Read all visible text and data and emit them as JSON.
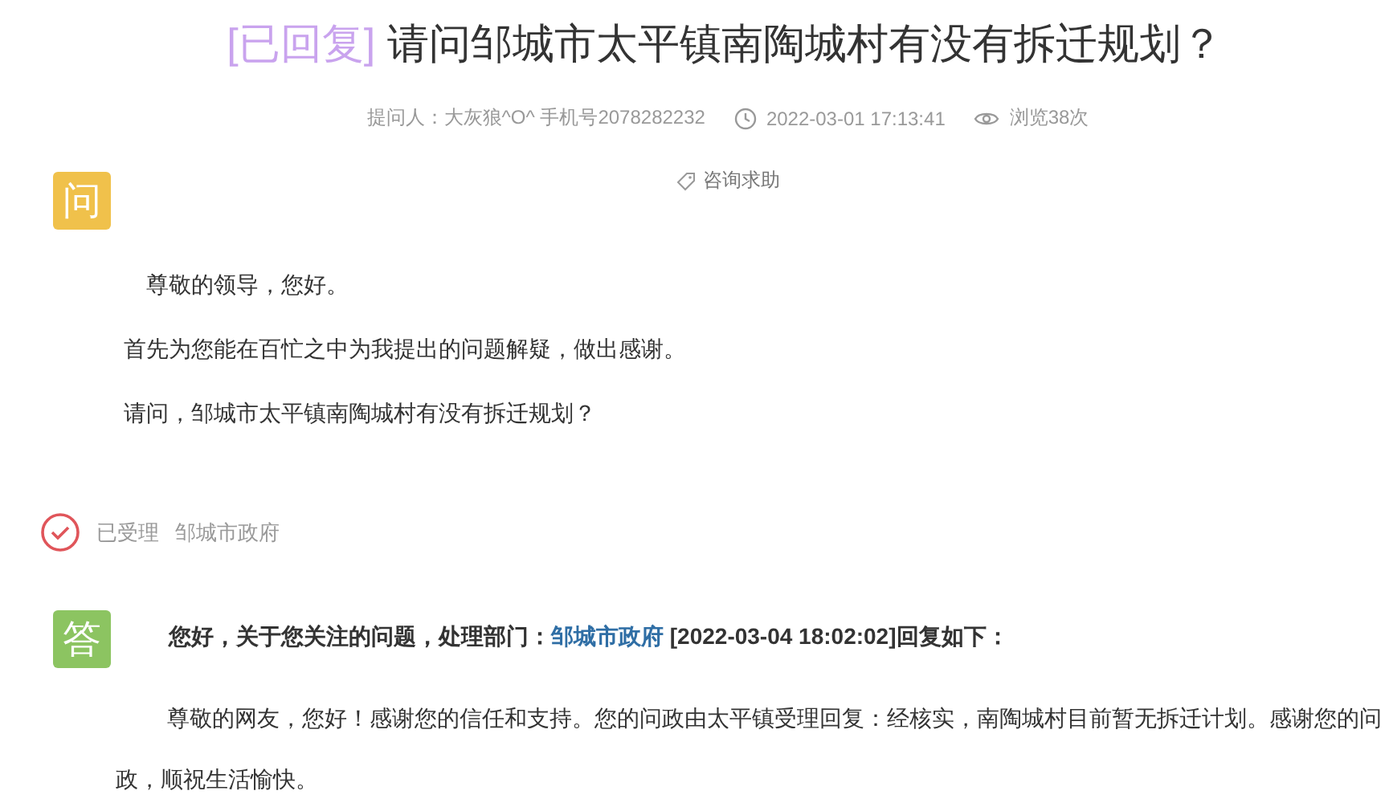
{
  "title": {
    "status": "[已回复]",
    "text": "请问邹城市太平镇南陶城村有没有拆迁规划？"
  },
  "meta": {
    "asker": "提问人：大灰狼^O^ 手机号2078282232",
    "time": "2022-03-01 17:13:41",
    "views": "浏览38次"
  },
  "tag": "咨询求助",
  "question": {
    "badge": "问",
    "paragraphs": [
      "尊敬的领导，您好。",
      "首先为您能在百忙之中为我提出的问题解疑，做出感谢。",
      "请问，邹城市太平镇南陶城村有没有拆迁规划？"
    ]
  },
  "status": {
    "state": "已受理",
    "department": "邹城市政府"
  },
  "answer": {
    "badge": "答",
    "header_prefix": "您好，关于您关注的问题，处理部门：",
    "department": "邹城市政府",
    "header_suffix": "[2022-03-04 18:02:02]回复如下：",
    "body": "尊敬的网友，您好！感谢您的信任和支持。您的问政由太平镇受理回复：经核实，南陶城村目前暂无拆迁计划。感谢您的问政，顺祝生活愉快。"
  }
}
